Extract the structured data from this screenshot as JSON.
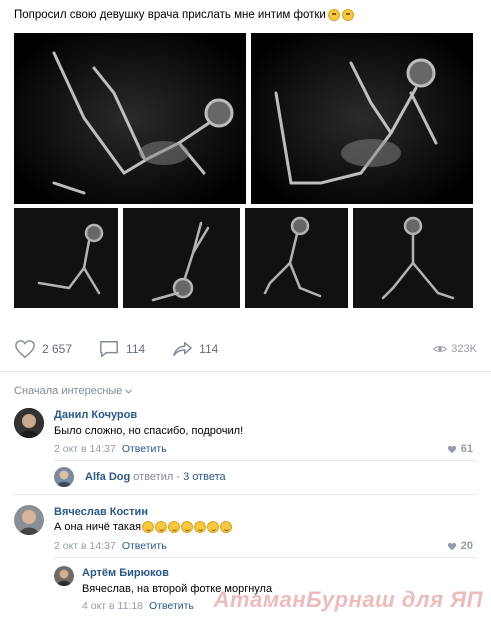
{
  "post": {
    "text": "Попросил свою девушку врача прислать мне интим фотки",
    "emoji": [
      "confused-face-icon",
      "unamused-face-icon"
    ]
  },
  "photos": {
    "large": [
      "xray-photo-1",
      "xray-photo-2"
    ],
    "small": [
      "xray-photo-3",
      "xray-photo-4",
      "xray-photo-5",
      "xray-photo-6"
    ]
  },
  "actions": {
    "likes": "2 657",
    "comments": "114",
    "shares": "114",
    "views": "323K"
  },
  "comments_header": {
    "sort_label": "Сначала интересные"
  },
  "comments": [
    {
      "author": "Данил Кочуров",
      "text": "Было сложно, но спасибо, подрочил!",
      "date": "2 окт в 14:37",
      "reply_label": "Ответить",
      "likes": "61",
      "thread": {
        "author": "Alfa Dog",
        "replied_word": "ответил",
        "count": "· 3 ответа"
      }
    },
    {
      "author": "Вячеслав Костин",
      "text": "А она ничё такая",
      "emoji_count": 7,
      "date": "2 окт в 14:37",
      "reply_label": "Ответить",
      "likes": "20",
      "reply": {
        "author": "Артём Бирюков",
        "text": "Вячеслав, на второй фотке моргнула",
        "date": "4 окт в 11:18",
        "reply_label": "Ответить"
      }
    }
  ],
  "watermark": "АтаманБурнаш для ЯП",
  "colors": {
    "link": "#2a5885",
    "meta": "#939ca8",
    "divider": "#e7e8ec"
  }
}
